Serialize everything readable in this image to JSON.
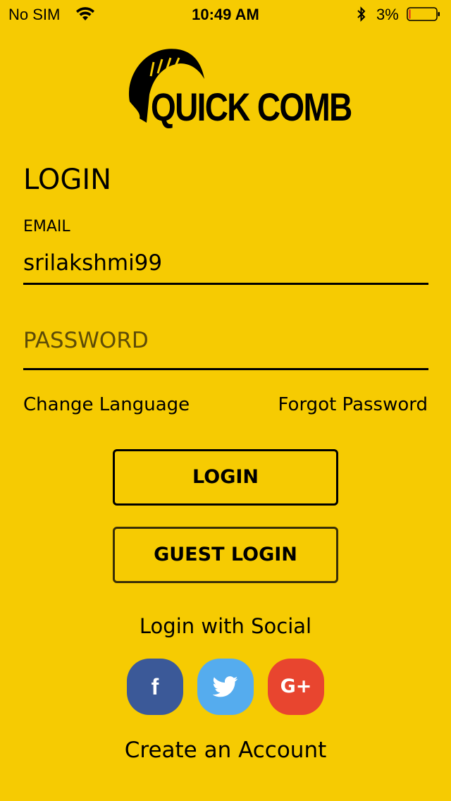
{
  "status_bar": {
    "carrier": "No SIM",
    "time": "10:49 AM",
    "battery_percent": "3%"
  },
  "app": {
    "logo_text": "QUICK COMB",
    "background_color": "#F6CB02"
  },
  "form": {
    "title": "LOGIN",
    "email_label": "EMAIL",
    "email_value": "srilakshmi99",
    "password_placeholder": "PASSWORD",
    "change_language": "Change Language",
    "forgot_password": "Forgot Password"
  },
  "buttons": {
    "login": "LOGIN",
    "guest_login": "GUEST LOGIN"
  },
  "social": {
    "title": "Login with Social",
    "facebook_glyph": "f",
    "google_glyph": "G+",
    "icons": [
      "facebook-icon",
      "twitter-icon",
      "google-plus-icon"
    ],
    "colors": {
      "facebook": "#3B5998",
      "twitter": "#55ACEE",
      "google": "#E8452F"
    }
  },
  "footer": {
    "create_account": "Create an Account"
  }
}
